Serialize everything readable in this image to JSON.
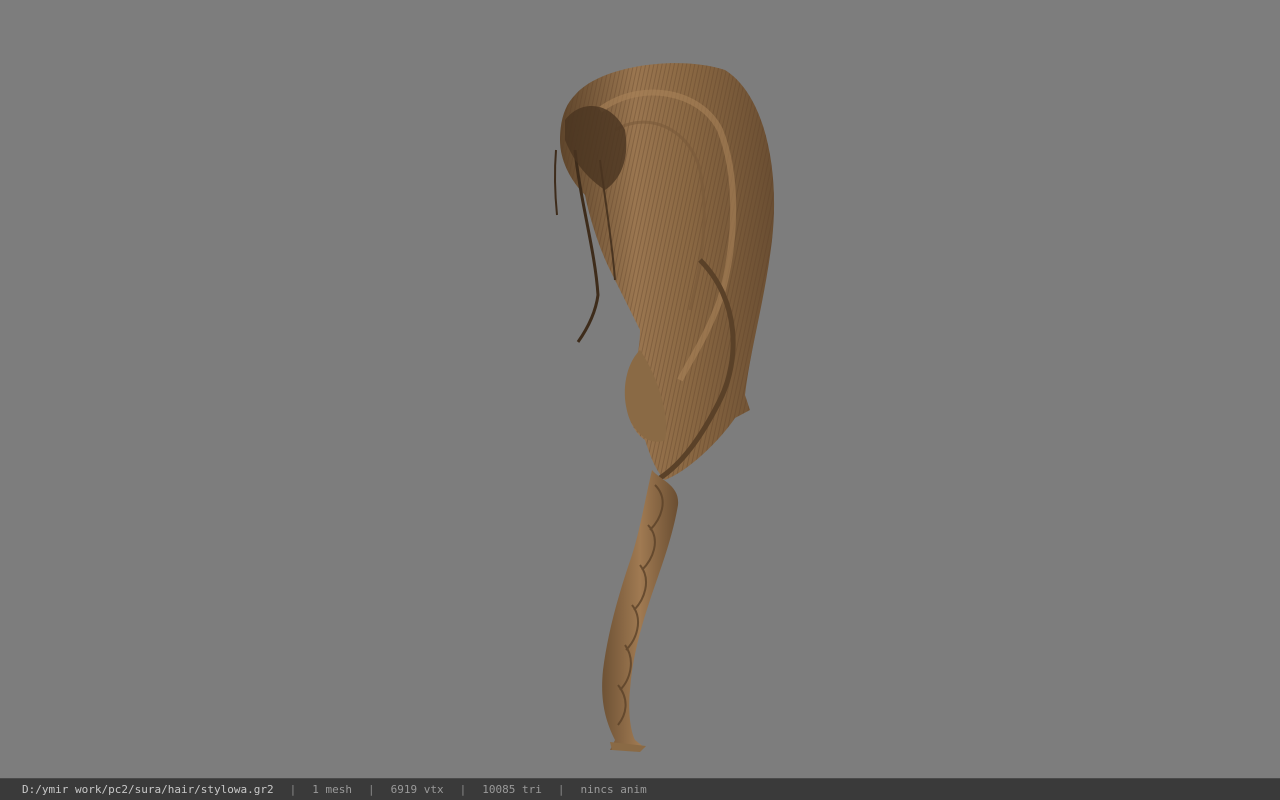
{
  "viewport": {
    "background_color": "#7d7d7d",
    "model": {
      "kind": "hair",
      "color": "#8c6a45"
    }
  },
  "status": {
    "file_path": "D:/ymir work/pc2/sura/hair/stylowa.gr2",
    "mesh_count": "1 mesh",
    "vertex_count": "6919 vtx",
    "triangle_count": "10085 tri",
    "anim_status": "nincs anim",
    "separator": "|"
  }
}
